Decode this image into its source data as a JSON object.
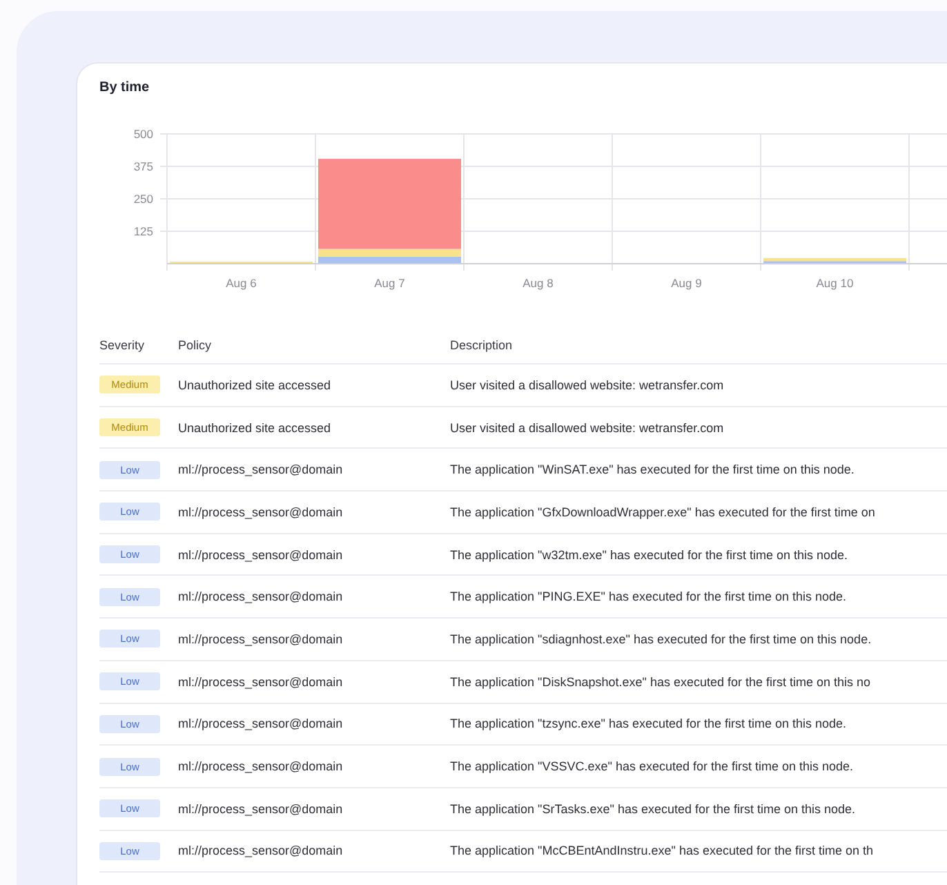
{
  "card": {
    "title": "By time",
    "chart_data": {
      "type": "bar",
      "stacked": true,
      "grid": true,
      "categories": [
        "Aug 6",
        "Aug 7",
        "Aug 8",
        "Aug 9",
        "Aug 10"
      ],
      "ylim": [
        0,
        500
      ],
      "yticks": [
        125,
        250,
        375,
        500
      ],
      "series": [
        {
          "color": "#a9c1ee",
          "values": [
            0,
            27,
            0,
            0,
            10
          ]
        },
        {
          "color": "#f9e38a",
          "values": [
            5,
            30,
            0,
            0,
            12
          ]
        },
        {
          "color": "#fb8c8c",
          "values": [
            0,
            347,
            0,
            0,
            0
          ]
        }
      ]
    }
  },
  "table": {
    "columns": [
      "Severity",
      "Policy",
      "Description"
    ],
    "rows": [
      {
        "severity": "Medium",
        "kind": "medium",
        "policy": "Unauthorized site accessed",
        "description": "User visited a disallowed website: wetransfer.com"
      },
      {
        "severity": "Medium",
        "kind": "medium",
        "policy": "Unauthorized site accessed",
        "description": "User visited a disallowed website: wetransfer.com"
      },
      {
        "severity": "Low",
        "kind": "low",
        "policy": "ml://process_sensor@domain",
        "description": "The application \"WinSAT.exe\" has executed for the first time on this node."
      },
      {
        "severity": "Low",
        "kind": "low",
        "policy": "ml://process_sensor@domain",
        "description": "The application \"GfxDownloadWrapper.exe\" has executed for the first time on"
      },
      {
        "severity": "Low",
        "kind": "low",
        "policy": "ml://process_sensor@domain",
        "description": "The application \"w32tm.exe\" has executed for the first time on this node."
      },
      {
        "severity": "Low",
        "kind": "low",
        "policy": "ml://process_sensor@domain",
        "description": "The application \"PING.EXE\" has executed for the first time on this node."
      },
      {
        "severity": "Low",
        "kind": "low",
        "policy": "ml://process_sensor@domain",
        "description": "The application \"sdiagnhost.exe\" has executed for the first time on this node."
      },
      {
        "severity": "Low",
        "kind": "low",
        "policy": "ml://process_sensor@domain",
        "description": "The application \"DiskSnapshot.exe\" has executed for the first time on this no"
      },
      {
        "severity": "Low",
        "kind": "low",
        "policy": "ml://process_sensor@domain",
        "description": "The application \"tzsync.exe\" has executed for the first time on this node."
      },
      {
        "severity": "Low",
        "kind": "low",
        "policy": "ml://process_sensor@domain",
        "description": "The application \"VSSVC.exe\" has executed for the first time on this node."
      },
      {
        "severity": "Low",
        "kind": "low",
        "policy": "ml://process_sensor@domain",
        "description": "The application \"SrTasks.exe\" has executed for the first time on this node."
      },
      {
        "severity": "Low",
        "kind": "low",
        "policy": "ml://process_sensor@domain",
        "description": "The application \"McCBEntAndInstru.exe\" has executed for the first time on th"
      }
    ]
  }
}
